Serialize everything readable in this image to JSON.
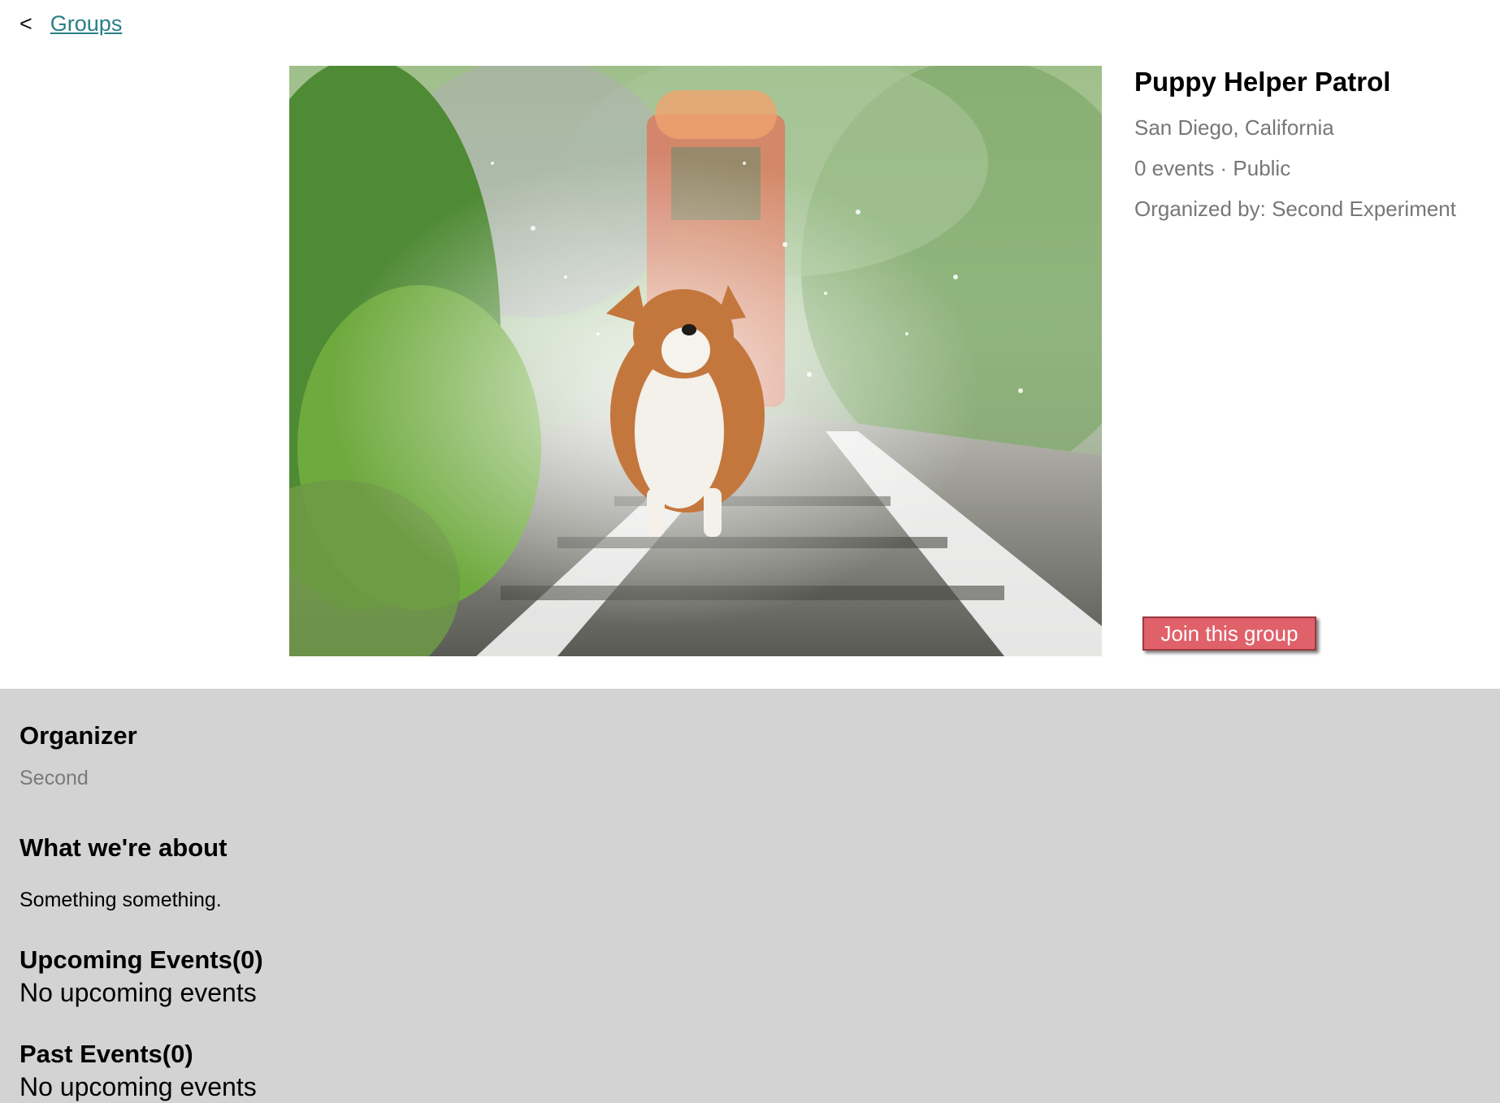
{
  "breadcrumb": {
    "back_glyph": "<",
    "link_label": "Groups"
  },
  "group": {
    "image_alt": "Corgi on railway tracks",
    "title": "Puppy Helper Patrol",
    "location": "San Diego, California",
    "events_visibility": "0 events · Public",
    "organized_by": "Organized by: Second Experiment",
    "join_label": "Join this group"
  },
  "details": {
    "organizer_heading": "Organizer",
    "organizer_name": "Second",
    "about_heading": "What we're about",
    "about_text": "Something something.",
    "upcoming_heading": "Upcoming Events(0)",
    "upcoming_empty": "No upcoming events",
    "past_heading": "Past Events(0)",
    "past_empty": "No upcoming events"
  },
  "colors": {
    "link": "#2a7f86",
    "join_button": "#e0616a",
    "details_background": "#d3d3d3",
    "muted_text": "#777777"
  }
}
